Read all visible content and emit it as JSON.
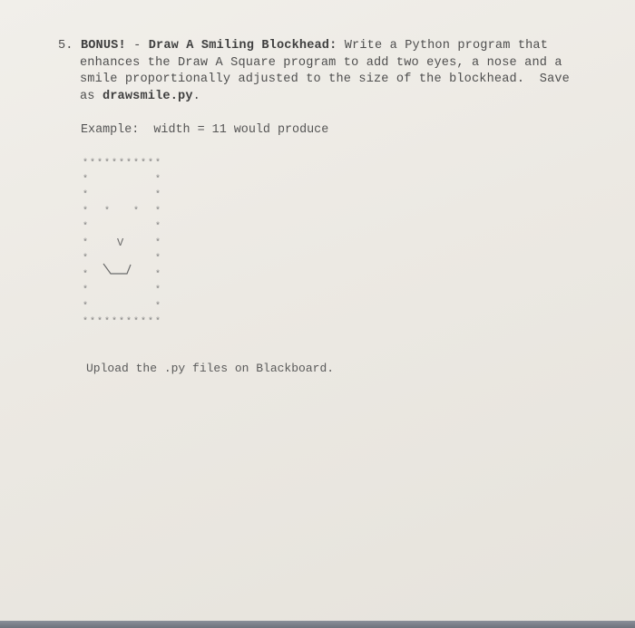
{
  "question": {
    "number": "5.",
    "title_bonus": "BONUS!",
    "dash": " - ",
    "title_name": "Draw A Smiling Blockhead:",
    "line1_rest": " Write a Python program that",
    "line2": "enhances the Draw A Square program to add two eyes, a nose and a",
    "line3": "smile proportionally adjusted to the size of the blockhead.  Save",
    "line4_prefix": "as ",
    "filename": "drawsmile.py",
    "line4_suffix": "."
  },
  "example": {
    "label": "Example:",
    "text": "  width = 11 would produce"
  },
  "blockhead": {
    "width": 11,
    "border_char": "*",
    "eye_char": "*",
    "nose_char": "V",
    "smile_text": "\\___/",
    "eyes_row": 3,
    "nose_row": 5,
    "smile_row": 7
  },
  "footer": {
    "upload_text": "Upload the .py files on Blackboard."
  }
}
